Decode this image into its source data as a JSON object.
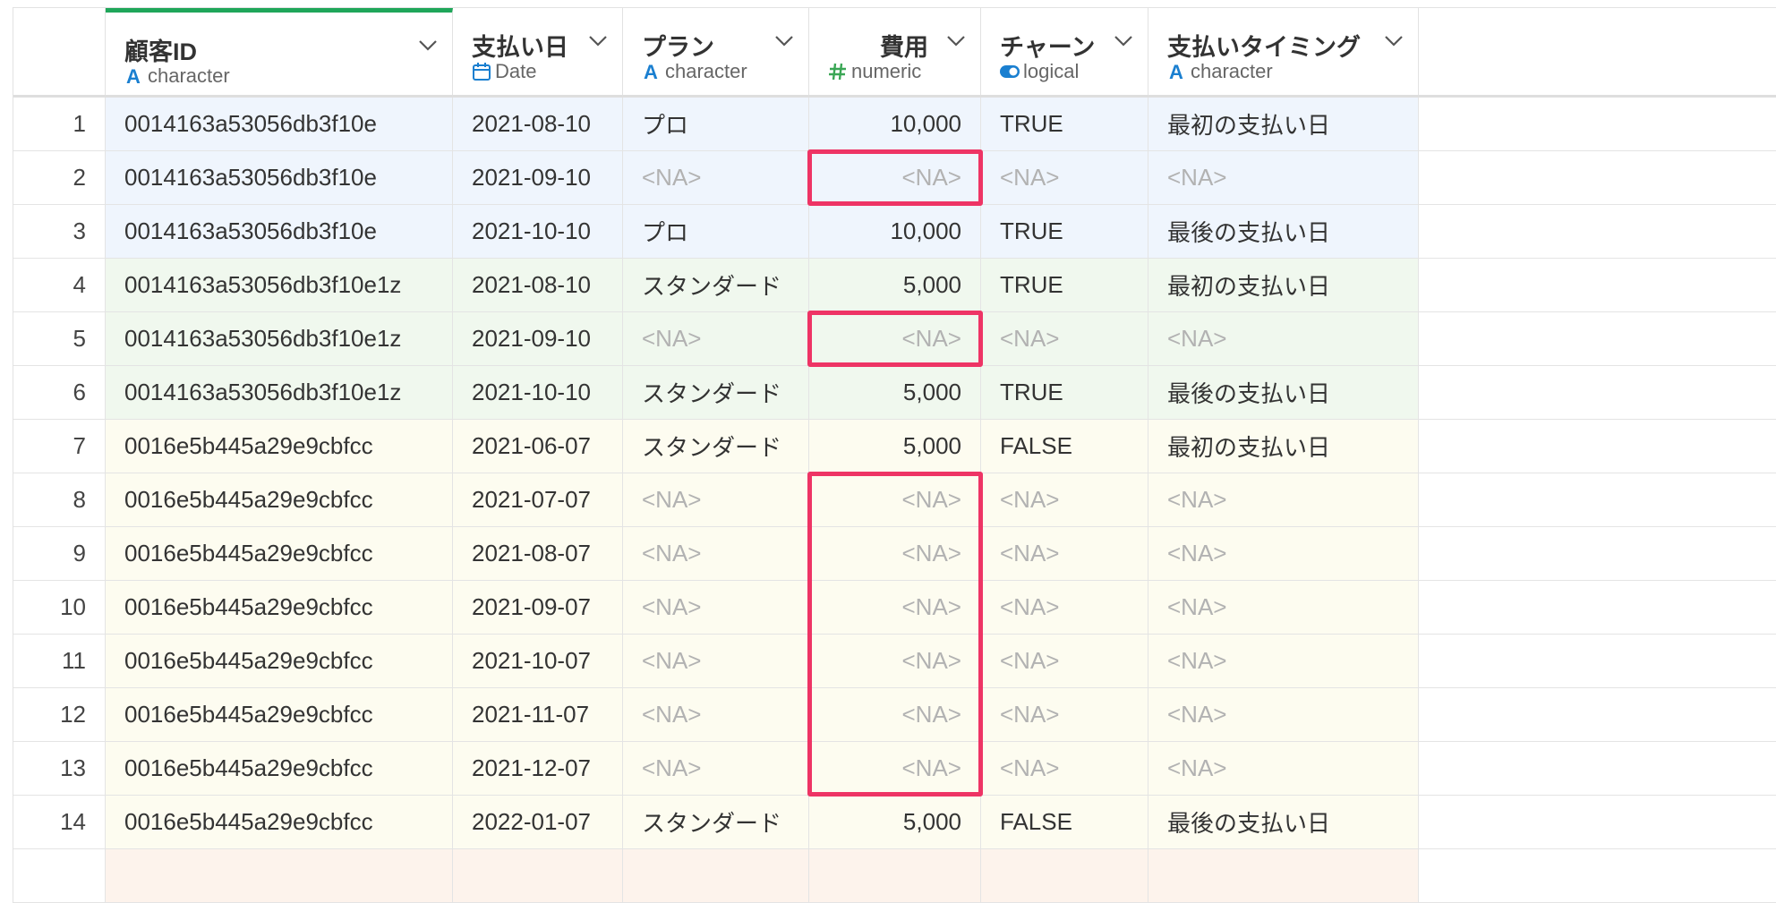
{
  "colors": {
    "accent_green": "#1fa65a",
    "highlight": "#ee3465",
    "group_blue": "#eff5fd",
    "group_green": "#f0f8ee",
    "group_yellow": "#fdfcf0",
    "na_text": "#b2b2b2"
  },
  "columns": [
    {
      "name": "顧客ID",
      "type": "character",
      "icon": "character-type-icon"
    },
    {
      "name": "支払い日",
      "type": "Date",
      "icon": "calendar-icon"
    },
    {
      "name": "プラン",
      "type": "character",
      "icon": "character-type-icon"
    },
    {
      "name": "費用",
      "type": "numeric",
      "icon": "hash-icon"
    },
    {
      "name": "チャーン",
      "type": "logical",
      "icon": "toggle-icon"
    },
    {
      "name": "支払いタイミング",
      "type": "character",
      "icon": "character-type-icon"
    }
  ],
  "rows": [
    {
      "i": "1",
      "group": "blue",
      "cells": [
        "0014163a53056db3f10e",
        "2021-08-10",
        "プロ",
        "10,000",
        "TRUE",
        "最初の支払い日"
      ]
    },
    {
      "i": "2",
      "group": "blue",
      "cells": [
        "0014163a53056db3f10e",
        "2021-09-10",
        "<NA>",
        "<NA>",
        "<NA>",
        "<NA>"
      ]
    },
    {
      "i": "3",
      "group": "blue",
      "cells": [
        "0014163a53056db3f10e",
        "2021-10-10",
        "プロ",
        "10,000",
        "TRUE",
        "最後の支払い日"
      ]
    },
    {
      "i": "4",
      "group": "green",
      "cells": [
        "0014163a53056db3f10e1z",
        "2021-08-10",
        "スタンダード",
        "5,000",
        "TRUE",
        "最初の支払い日"
      ]
    },
    {
      "i": "5",
      "group": "green",
      "cells": [
        "0014163a53056db3f10e1z",
        "2021-09-10",
        "<NA>",
        "<NA>",
        "<NA>",
        "<NA>"
      ]
    },
    {
      "i": "6",
      "group": "green",
      "cells": [
        "0014163a53056db3f10e1z",
        "2021-10-10",
        "スタンダード",
        "5,000",
        "TRUE",
        "最後の支払い日"
      ]
    },
    {
      "i": "7",
      "group": "yellow",
      "cells": [
        "0016e5b445a29e9cbfcc",
        "2021-06-07",
        "スタンダード",
        "5,000",
        "FALSE",
        "最初の支払い日"
      ]
    },
    {
      "i": "8",
      "group": "yellow",
      "cells": [
        "0016e5b445a29e9cbfcc",
        "2021-07-07",
        "<NA>",
        "<NA>",
        "<NA>",
        "<NA>"
      ]
    },
    {
      "i": "9",
      "group": "yellow",
      "cells": [
        "0016e5b445a29e9cbfcc",
        "2021-08-07",
        "<NA>",
        "<NA>",
        "<NA>",
        "<NA>"
      ]
    },
    {
      "i": "10",
      "group": "yellow",
      "cells": [
        "0016e5b445a29e9cbfcc",
        "2021-09-07",
        "<NA>",
        "<NA>",
        "<NA>",
        "<NA>"
      ]
    },
    {
      "i": "11",
      "group": "yellow",
      "cells": [
        "0016e5b445a29e9cbfcc",
        "2021-10-07",
        "<NA>",
        "<NA>",
        "<NA>",
        "<NA>"
      ]
    },
    {
      "i": "12",
      "group": "yellow",
      "cells": [
        "0016e5b445a29e9cbfcc",
        "2021-11-07",
        "<NA>",
        "<NA>",
        "<NA>",
        "<NA>"
      ]
    },
    {
      "i": "13",
      "group": "yellow",
      "cells": [
        "0016e5b445a29e9cbfcc",
        "2021-12-07",
        "<NA>",
        "<NA>",
        "<NA>",
        "<NA>"
      ]
    },
    {
      "i": "14",
      "group": "yellow",
      "cells": [
        "0016e5b445a29e9cbfcc",
        "2022-01-07",
        "スタンダード",
        "5,000",
        "FALSE",
        "最後の支払い日"
      ]
    },
    {
      "i": "",
      "group": "peach",
      "cells": [
        "",
        "",
        "",
        "",
        "",
        ""
      ]
    }
  ],
  "highlights": [
    {
      "column": 3,
      "from_row": 2,
      "to_row": 2
    },
    {
      "column": 3,
      "from_row": 5,
      "to_row": 5
    },
    {
      "column": 3,
      "from_row": 8,
      "to_row": 13
    }
  ]
}
